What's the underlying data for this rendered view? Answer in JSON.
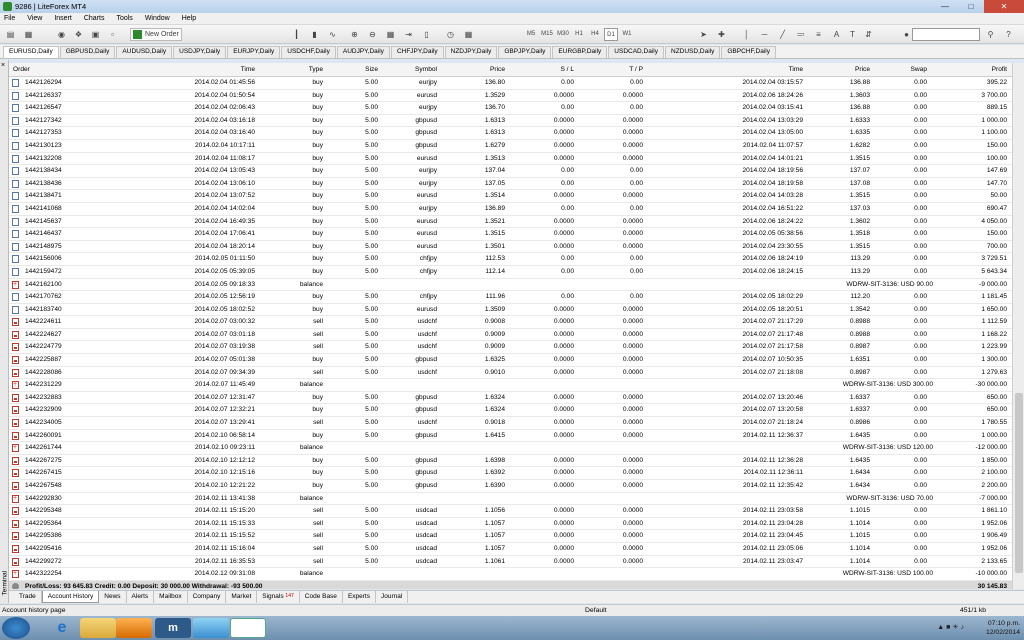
{
  "window": {
    "title": "9286 | LiteForex MT4"
  },
  "menu": [
    "File",
    "View",
    "Insert",
    "Charts",
    "Tools",
    "Window",
    "Help"
  ],
  "toolbar": {
    "new_order": "New Order",
    "timeframes": [
      "M5",
      "M15",
      "M30",
      "H1",
      "H4",
      "D1",
      "W1"
    ],
    "active_timeframe": "D1"
  },
  "chart_tabs": [
    "EURUSD,Daily",
    "GBPUSD,Daily",
    "AUDUSD,Daily",
    "USDJPY,Daily",
    "EURJPY,Daily",
    "USDCHF,Daily",
    "AUDJPY,Daily",
    "CHFJPY,Daily",
    "NZDJPY,Daily",
    "GBPJPY,Daily",
    "EURGBP,Daily",
    "USDCAD,Daily",
    "NZDUSD,Daily",
    "GBPCHF,Daily"
  ],
  "columns": {
    "order": "Order",
    "time": "Time",
    "type": "Type",
    "size": "Size",
    "symbol": "Symbol",
    "price": "Price",
    "sl": "S / L",
    "tp": "T / P",
    "close_time": "Time",
    "close_price": "Price",
    "swap": "Swap",
    "profit": "Profit"
  },
  "rows": [
    {
      "order": "1442126294",
      "time": "2014.02.04 01:45:56",
      "type": "buy",
      "size": "5.00",
      "symbol": "eurjpy",
      "price": "136.80",
      "sl": "0.00",
      "tp": "0.00",
      "close_time": "2014.02.04 03:15:57",
      "close_price": "136.88",
      "swap": "0.00",
      "profit": "395.22",
      "kind": "buy"
    },
    {
      "order": "1442126337",
      "time": "2014.02.04 01:50:54",
      "type": "buy",
      "size": "5.00",
      "symbol": "eurusd",
      "price": "1.3529",
      "sl": "0.0000",
      "tp": "0.0000",
      "close_time": "2014.02.06 18:24:26",
      "close_price": "1.3603",
      "swap": "0.00",
      "profit": "3 700.00",
      "kind": "buy"
    },
    {
      "order": "1442126547",
      "time": "2014.02.04 02:06:43",
      "type": "buy",
      "size": "5.00",
      "symbol": "eurjpy",
      "price": "136.70",
      "sl": "0.00",
      "tp": "0.00",
      "close_time": "2014.02.04 03:15:41",
      "close_price": "136.88",
      "swap": "0.00",
      "profit": "889.15",
      "kind": "buy"
    },
    {
      "order": "1442127342",
      "time": "2014.02.04 03:16:18",
      "type": "buy",
      "size": "5.00",
      "symbol": "gbpusd",
      "price": "1.6313",
      "sl": "0.0000",
      "tp": "0.0000",
      "close_time": "2014.02.04 13:03:29",
      "close_price": "1.6333",
      "swap": "0.00",
      "profit": "1 000.00",
      "kind": "buy"
    },
    {
      "order": "1442127353",
      "time": "2014.02.04 03:16:40",
      "type": "buy",
      "size": "5.00",
      "symbol": "gbpusd",
      "price": "1.6313",
      "sl": "0.0000",
      "tp": "0.0000",
      "close_time": "2014.02.04 13:05:00",
      "close_price": "1.6335",
      "swap": "0.00",
      "profit": "1 100.00",
      "kind": "buy"
    },
    {
      "order": "1442130123",
      "time": "2014.02.04 10:17:11",
      "type": "buy",
      "size": "5.00",
      "symbol": "gbpusd",
      "price": "1.6279",
      "sl": "0.0000",
      "tp": "0.0000",
      "close_time": "2014.02.04 11:07:57",
      "close_price": "1.6282",
      "swap": "0.00",
      "profit": "150.00",
      "kind": "buy"
    },
    {
      "order": "1442132208",
      "time": "2014.02.04 11:08:17",
      "type": "buy",
      "size": "5.00",
      "symbol": "eurusd",
      "price": "1.3513",
      "sl": "0.0000",
      "tp": "0.0000",
      "close_time": "2014.02.04 14:01:21",
      "close_price": "1.3515",
      "swap": "0.00",
      "profit": "100.00",
      "kind": "buy"
    },
    {
      "order": "1442138434",
      "time": "2014.02.04 13:05:43",
      "type": "buy",
      "size": "5.00",
      "symbol": "eurjpy",
      "price": "137.04",
      "sl": "0.00",
      "tp": "0.00",
      "close_time": "2014.02.04 18:19:56",
      "close_price": "137.07",
      "swap": "0.00",
      "profit": "147.69",
      "kind": "buy"
    },
    {
      "order": "1442138436",
      "time": "2014.02.04 13:06:10",
      "type": "buy",
      "size": "5.00",
      "symbol": "eurjpy",
      "price": "137.05",
      "sl": "0.00",
      "tp": "0.00",
      "close_time": "2014.02.04 18:19:58",
      "close_price": "137.08",
      "swap": "0.00",
      "profit": "147.70",
      "kind": "buy"
    },
    {
      "order": "1442138471",
      "time": "2014.02.04 13:07:52",
      "type": "buy",
      "size": "5.00",
      "symbol": "eurusd",
      "price": "1.3514",
      "sl": "0.0000",
      "tp": "0.0000",
      "close_time": "2014.02.04 14:03:28",
      "close_price": "1.3515",
      "swap": "0.00",
      "profit": "50.00",
      "kind": "buy"
    },
    {
      "order": "1442141068",
      "time": "2014.02.04 14:02:04",
      "type": "buy",
      "size": "5.00",
      "symbol": "eurjpy",
      "price": "136.89",
      "sl": "0.00",
      "tp": "0.00",
      "close_time": "2014.02.04 16:51:22",
      "close_price": "137.03",
      "swap": "0.00",
      "profit": "690.47",
      "kind": "buy"
    },
    {
      "order": "1442145637",
      "time": "2014.02.04 16:49:35",
      "type": "buy",
      "size": "5.00",
      "symbol": "eurusd",
      "price": "1.3521",
      "sl": "0.0000",
      "tp": "0.0000",
      "close_time": "2014.02.06 18:24:22",
      "close_price": "1.3602",
      "swap": "0.00",
      "profit": "4 050.00",
      "kind": "buy"
    },
    {
      "order": "1442146437",
      "time": "2014.02.04 17:06:41",
      "type": "buy",
      "size": "5.00",
      "symbol": "eurusd",
      "price": "1.3515",
      "sl": "0.0000",
      "tp": "0.0000",
      "close_time": "2014.02.05 05:38:56",
      "close_price": "1.3518",
      "swap": "0.00",
      "profit": "150.00",
      "kind": "buy"
    },
    {
      "order": "1442148975",
      "time": "2014.02.04 18:20:14",
      "type": "buy",
      "size": "5.00",
      "symbol": "eurusd",
      "price": "1.3501",
      "sl": "0.0000",
      "tp": "0.0000",
      "close_time": "2014.02.04 23:30:55",
      "close_price": "1.3515",
      "swap": "0.00",
      "profit": "700.00",
      "kind": "buy"
    },
    {
      "order": "1442156006",
      "time": "2014.02.05 01:11:50",
      "type": "buy",
      "size": "5.00",
      "symbol": "chfjpy",
      "price": "112.53",
      "sl": "0.00",
      "tp": "0.00",
      "close_time": "2014.02.06 18:24:19",
      "close_price": "113.29",
      "swap": "0.00",
      "profit": "3 729.51",
      "kind": "buy"
    },
    {
      "order": "1442159472",
      "time": "2014.02.05 05:39:05",
      "type": "buy",
      "size": "5.00",
      "symbol": "chfjpy",
      "price": "112.14",
      "sl": "0.00",
      "tp": "0.00",
      "close_time": "2014.02.06 18:24:15",
      "close_price": "113.29",
      "swap": "0.00",
      "profit": "5 643.34",
      "kind": "buy"
    },
    {
      "order": "1442162100",
      "time": "2014.02.05 09:18:33",
      "type": "balance",
      "comment": "WDRW-SIT-3136: USD 90.00",
      "profit": "-9 000.00",
      "kind": "balance"
    },
    {
      "order": "1442170762",
      "time": "2014.02.05 12:56:19",
      "type": "buy",
      "size": "5.00",
      "symbol": "chfjpy",
      "price": "111.96",
      "sl": "0.00",
      "tp": "0.00",
      "close_time": "2014.02.05 18:02:29",
      "close_price": "112.20",
      "swap": "0.00",
      "profit": "1 181.45",
      "kind": "buy"
    },
    {
      "order": "1442183740",
      "time": "2014.02.05 18:02:52",
      "type": "buy",
      "size": "5.00",
      "symbol": "eurusd",
      "price": "1.3509",
      "sl": "0.0000",
      "tp": "0.0000",
      "close_time": "2014.02.05 18:20:51",
      "close_price": "1.3542",
      "swap": "0.00",
      "profit": "1 650.00",
      "kind": "buy"
    },
    {
      "order": "1442224611",
      "time": "2014.02.07 03:00:32",
      "type": "sell",
      "size": "5.00",
      "symbol": "usdchf",
      "price": "0.9008",
      "sl": "0.0000",
      "tp": "0.0000",
      "close_time": "2014.02.07 21:17:29",
      "close_price": "0.8988",
      "swap": "0.00",
      "profit": "1 112.59",
      "kind": "sell"
    },
    {
      "order": "1442224627",
      "time": "2014.02.07 03:01:18",
      "type": "sell",
      "size": "5.00",
      "symbol": "usdchf",
      "price": "0.9009",
      "sl": "0.0000",
      "tp": "0.0000",
      "close_time": "2014.02.07 21:17:48",
      "close_price": "0.8988",
      "swap": "0.00",
      "profit": "1 168.22",
      "kind": "sell"
    },
    {
      "order": "1442224779",
      "time": "2014.02.07 03:19:38",
      "type": "sell",
      "size": "5.00",
      "symbol": "usdchf",
      "price": "0.9009",
      "sl": "0.0000",
      "tp": "0.0000",
      "close_time": "2014.02.07 21:17:58",
      "close_price": "0.8987",
      "swap": "0.00",
      "profit": "1 223.99",
      "kind": "sell"
    },
    {
      "order": "1442225887",
      "time": "2014.02.07 05:01:38",
      "type": "buy",
      "size": "5.00",
      "symbol": "gbpusd",
      "price": "1.6325",
      "sl": "0.0000",
      "tp": "0.0000",
      "close_time": "2014.02.07 10:50:35",
      "close_price": "1.6351",
      "swap": "0.00",
      "profit": "1 300.00",
      "kind": "sell"
    },
    {
      "order": "1442228086",
      "time": "2014.02.07 09:34:39",
      "type": "sell",
      "size": "5.00",
      "symbol": "usdchf",
      "price": "0.9010",
      "sl": "0.0000",
      "tp": "0.0000",
      "close_time": "2014.02.07 21:18:08",
      "close_price": "0.8987",
      "swap": "0.00",
      "profit": "1 279.63",
      "kind": "sell"
    },
    {
      "order": "1442231229",
      "time": "2014.02.07 11:45:49",
      "type": "balance",
      "comment": "WDRW-SIT-3136: USD 300.00",
      "profit": "-30 000.00",
      "kind": "balance"
    },
    {
      "order": "1442232883",
      "time": "2014.02.07 12:31:47",
      "type": "buy",
      "size": "5.00",
      "symbol": "gbpusd",
      "price": "1.6324",
      "sl": "0.0000",
      "tp": "0.0000",
      "close_time": "2014.02.07 13:20:46",
      "close_price": "1.6337",
      "swap": "0.00",
      "profit": "650.00",
      "kind": "sell"
    },
    {
      "order": "1442232909",
      "time": "2014.02.07 12:32:21",
      "type": "buy",
      "size": "5.00",
      "symbol": "gbpusd",
      "price": "1.6324",
      "sl": "0.0000",
      "tp": "0.0000",
      "close_time": "2014.02.07 13:20:58",
      "close_price": "1.6337",
      "swap": "0.00",
      "profit": "650.00",
      "kind": "sell"
    },
    {
      "order": "1442234005",
      "time": "2014.02.07 13:29:41",
      "type": "sell",
      "size": "5.00",
      "symbol": "usdchf",
      "price": "0.9018",
      "sl": "0.0000",
      "tp": "0.0000",
      "close_time": "2014.02.07 21:18:24",
      "close_price": "0.8986",
      "swap": "0.00",
      "profit": "1 780.55",
      "kind": "sell"
    },
    {
      "order": "1442260091",
      "time": "2014.02.10 06:58:14",
      "type": "buy",
      "size": "5.00",
      "symbol": "gbpusd",
      "price": "1.6415",
      "sl": "0.0000",
      "tp": "0.0000",
      "close_time": "2014.02.11 12:36:37",
      "close_price": "1.6435",
      "swap": "0.00",
      "profit": "1 000.00",
      "kind": "sell"
    },
    {
      "order": "1442261744",
      "time": "2014.02.10 09:23:11",
      "type": "balance",
      "comment": "WDRW-SIT-3136: USD 120.00",
      "profit": "-12 000.00",
      "kind": "balance"
    },
    {
      "order": "1442267275",
      "time": "2014.02.10 12:12:12",
      "type": "buy",
      "size": "5.00",
      "symbol": "gbpusd",
      "price": "1.6398",
      "sl": "0.0000",
      "tp": "0.0000",
      "close_time": "2014.02.11 12:36:28",
      "close_price": "1.6435",
      "swap": "0.00",
      "profit": "1 850.00",
      "kind": "sell"
    },
    {
      "order": "1442267415",
      "time": "2014.02.10 12:15:16",
      "type": "buy",
      "size": "5.00",
      "symbol": "gbpusd",
      "price": "1.6392",
      "sl": "0.0000",
      "tp": "0.0000",
      "close_time": "2014.02.11 12:36:11",
      "close_price": "1.6434",
      "swap": "0.00",
      "profit": "2 100.00",
      "kind": "sell"
    },
    {
      "order": "1442267548",
      "time": "2014.02.10 12:21:22",
      "type": "buy",
      "size": "5.00",
      "symbol": "gbpusd",
      "price": "1.6390",
      "sl": "0.0000",
      "tp": "0.0000",
      "close_time": "2014.02.11 12:35:42",
      "close_price": "1.6434",
      "swap": "0.00",
      "profit": "2 200.00",
      "kind": "sell"
    },
    {
      "order": "1442292830",
      "time": "2014.02.11 13:41:38",
      "type": "balance",
      "comment": "WDRW-SIT-3136: USD 70.00",
      "profit": "-7 000.00",
      "kind": "balance"
    },
    {
      "order": "1442295348",
      "time": "2014.02.11 15:15:20",
      "type": "sell",
      "size": "5.00",
      "symbol": "usdcad",
      "price": "1.1056",
      "sl": "0.0000",
      "tp": "0.0000",
      "close_time": "2014.02.11 23:03:58",
      "close_price": "1.1015",
      "swap": "0.00",
      "profit": "1 861.10",
      "kind": "sell"
    },
    {
      "order": "1442295364",
      "time": "2014.02.11 15:15:33",
      "type": "sell",
      "size": "5.00",
      "symbol": "usdcad",
      "price": "1.1057",
      "sl": "0.0000",
      "tp": "0.0000",
      "close_time": "2014.02.11 23:04:28",
      "close_price": "1.1014",
      "swap": "0.00",
      "profit": "1 952.06",
      "kind": "sell"
    },
    {
      "order": "1442295386",
      "time": "2014.02.11 15:15:52",
      "type": "sell",
      "size": "5.00",
      "symbol": "usdcad",
      "price": "1.1057",
      "sl": "0.0000",
      "tp": "0.0000",
      "close_time": "2014.02.11 23:04:45",
      "close_price": "1.1015",
      "swap": "0.00",
      "profit": "1 906.49",
      "kind": "sell"
    },
    {
      "order": "1442295416",
      "time": "2014.02.11 15:16:04",
      "type": "sell",
      "size": "5.00",
      "symbol": "usdcad",
      "price": "1.1057",
      "sl": "0.0000",
      "tp": "0.0000",
      "close_time": "2014.02.11 23:05:06",
      "close_price": "1.1014",
      "swap": "0.00",
      "profit": "1 952.06",
      "kind": "sell"
    },
    {
      "order": "1442299272",
      "time": "2014.02.11 16:35:53",
      "type": "sell",
      "size": "5.00",
      "symbol": "usdcad",
      "price": "1.1061",
      "sl": "0.0000",
      "tp": "0.0000",
      "close_time": "2014.02.11 23:03:47",
      "close_price": "1.1014",
      "swap": "0.00",
      "profit": "2 133.65",
      "kind": "sell"
    },
    {
      "order": "1442322254",
      "time": "2014.02.12 09:31:08",
      "type": "balance",
      "comment": "WDRW-SIT-3136: USD 100.00",
      "profit": "-10 000.00",
      "kind": "balance"
    }
  ],
  "totals": {
    "text": "Profit/Loss: 93 645.83  Credit: 0.00  Deposit: 30 000.00  Withdrawal: -93 500.00",
    "profit": "30 145.83"
  },
  "bottom_tabs": [
    {
      "label": "Trade",
      "active": false
    },
    {
      "label": "Account History",
      "active": true
    },
    {
      "label": "News",
      "active": false
    },
    {
      "label": "Alerts",
      "active": false
    },
    {
      "label": "Mailbox",
      "active": false
    },
    {
      "label": "Company",
      "active": false
    },
    {
      "label": "Market",
      "active": false
    },
    {
      "label": "Signals",
      "badge": "147",
      "active": false
    },
    {
      "label": "Code Base",
      "active": false
    },
    {
      "label": "Experts",
      "active": false
    },
    {
      "label": "Journal",
      "active": false
    }
  ],
  "terminal_label": "Terminal",
  "status": {
    "left": "Account history page",
    "profile": "Default",
    "traffic": "451/1 kb"
  },
  "clock": {
    "time": "07:10 p.m.",
    "date": "12/02/2014"
  }
}
